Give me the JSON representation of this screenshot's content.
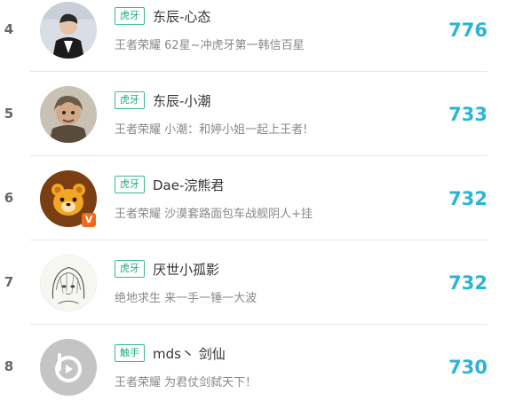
{
  "entries": [
    {
      "rank": "4",
      "platform": "虎牙",
      "name": "东辰-心态",
      "desc": "王者荣耀 62星~冲虎牙第一韩信百星",
      "score": "776",
      "avatar_icon": "person-suit-avatar"
    },
    {
      "rank": "5",
      "platform": "虎牙",
      "name": "东辰-小潮",
      "desc": "王者荣耀 小潮：和婷小姐一起上王者!",
      "score": "733",
      "avatar_icon": "person-avatar"
    },
    {
      "rank": "6",
      "platform": "虎牙",
      "name": "Dae-浣熊君",
      "desc": "王者荣耀 沙漠套路面包车战舰阴人+挂",
      "score": "732",
      "avatar_icon": "bear-avatar",
      "badge": "V"
    },
    {
      "rank": "7",
      "platform": "虎牙",
      "name": "厌世小孤影",
      "desc": "绝地求生 来一手一锤一大波",
      "score": "732",
      "avatar_icon": "anime-sketch-avatar"
    },
    {
      "rank": "8",
      "platform": "触手",
      "name": "mds丶 剑仙",
      "desc": "王者荣耀 为君仗剑弑天下！",
      "score": "730",
      "avatar_icon": "play-logo-avatar"
    }
  ],
  "colors": {
    "accent_green": "#1aad7a",
    "score_blue": "#2bb3d8",
    "badge_orange": "#f06a1d"
  }
}
